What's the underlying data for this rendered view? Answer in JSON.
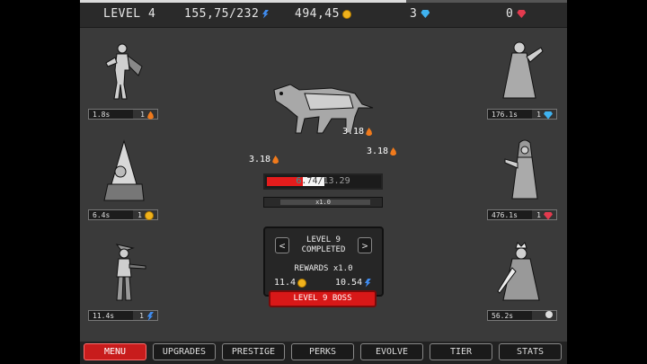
{
  "topbar": {
    "level": "LEVEL 4",
    "energy": "155,75/232",
    "gold": "494,45",
    "gems": "3",
    "rubies": "0",
    "progress": 0.67
  },
  "heroes": [
    {
      "time": "1.8s",
      "level": "1",
      "currency": "flame"
    },
    {
      "time": "6.4s",
      "level": "1",
      "currency": "coin"
    },
    {
      "time": "11.4s",
      "level": "1",
      "currency": "bolt"
    },
    {
      "time": "176.1s",
      "level": "1",
      "currency": "gem"
    },
    {
      "time": "476.1s",
      "level": "1",
      "currency": "ruby"
    },
    {
      "time": "56.2s",
      "level": "",
      "currency": "skull"
    }
  ],
  "enemy": {
    "name": "wolf",
    "hp_text": "6.74/13.29",
    "hp_fraction": 0.51,
    "multiplier": "x1.0"
  },
  "damage_popups": [
    "3.18",
    "3.18",
    "3.18"
  ],
  "level_panel": {
    "line1": "LEVEL 9",
    "line2": "COMPLETED",
    "rewards": "REWARDS x1.0",
    "gold_reward": "11.4",
    "energy_reward": "10.54",
    "prev_arrow": "<",
    "next_arrow": ">"
  },
  "boss_button": "LEVEL 9 BOSS",
  "nav": [
    "MENU",
    "UPGRADES",
    "PRESTIGE",
    "PERKS",
    "EVOLVE",
    "TIER",
    "STATS"
  ],
  "colors": {
    "accent": "#d81818",
    "coin": "#f0b21c",
    "gem": "#3fb2f0",
    "ruby": "#e23a4e",
    "bolt": "#3f8cf0"
  }
}
